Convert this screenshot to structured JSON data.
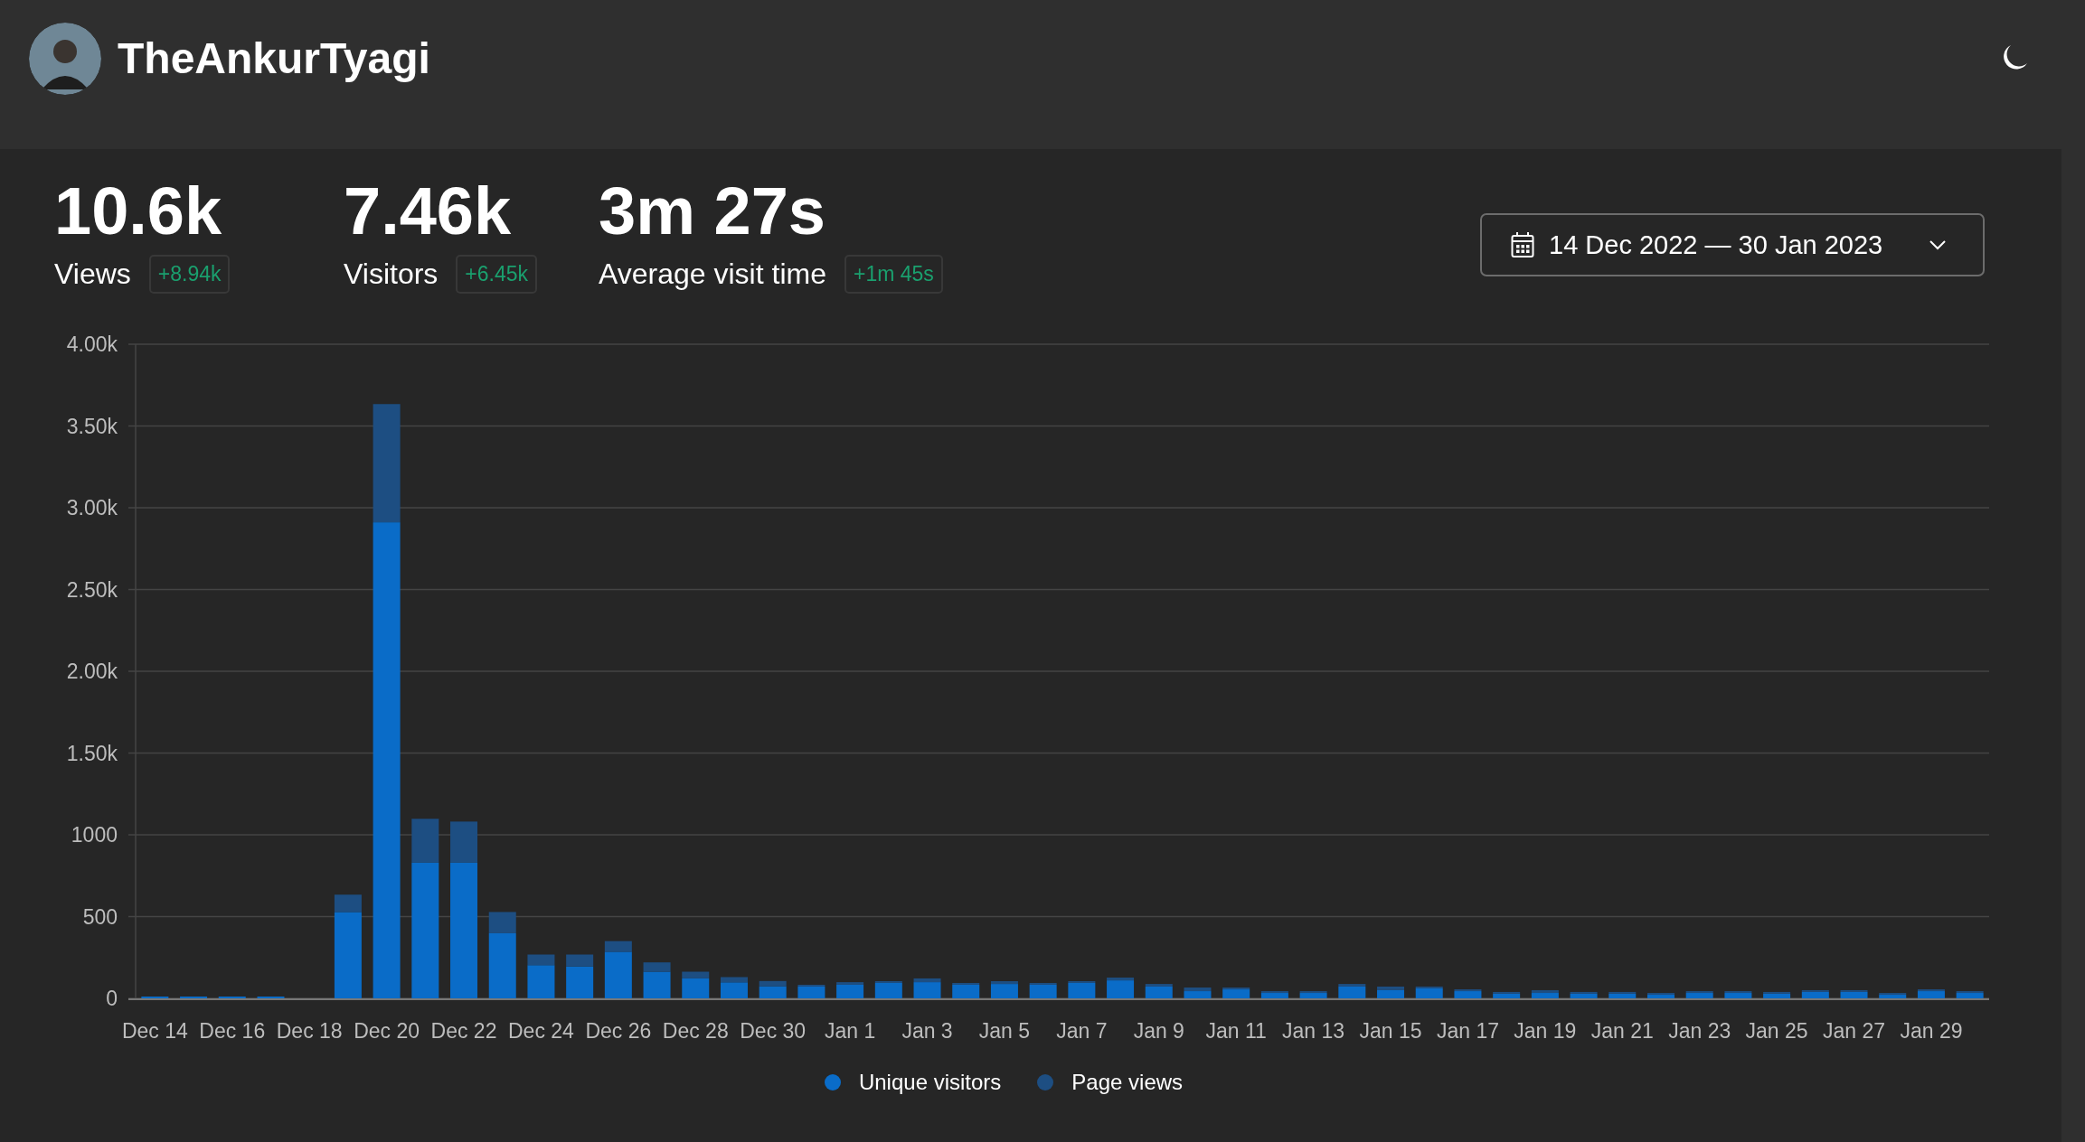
{
  "header": {
    "title": "TheAnkurTyagi"
  },
  "stats": [
    {
      "value": "10.6k",
      "label": "Views",
      "change": "+8.94k"
    },
    {
      "value": "7.46k",
      "label": "Visitors",
      "change": "+6.45k"
    },
    {
      "value": "3m 27s",
      "label": "Average visit time",
      "change": "+1m 45s"
    }
  ],
  "date_range": {
    "label": "14 Dec 2022 — 30 Jan 2023"
  },
  "chart": {
    "chart_data": {
      "type": "bar",
      "stacked": true,
      "grid": true,
      "categories": [
        "Dec 14",
        null,
        "Dec 16",
        null,
        "Dec 18",
        null,
        "Dec 20",
        null,
        "Dec 22",
        null,
        "Dec 24",
        null,
        "Dec 26",
        null,
        "Dec 28",
        null,
        "Dec 30",
        null,
        "Jan 1",
        null,
        "Jan 3",
        null,
        "Jan 5",
        null,
        "Jan 7",
        null,
        "Jan 9",
        null,
        "Jan 11",
        null,
        "Jan 13",
        null,
        "Jan 15",
        null,
        "Jan 17",
        null,
        "Jan 19",
        null,
        "Jan 21",
        null,
        "Jan 23",
        null,
        "Jan 25",
        null,
        "Jan 27",
        null,
        "Jan 29",
        null
      ],
      "series": [
        {
          "name": "Unique visitors",
          "color": "#0a6cc8",
          "values": [
            8,
            6,
            4,
            4,
            0,
            528,
            2911,
            829,
            829,
            398,
            203,
            195,
            285,
            163,
            122,
            98,
            73,
            72,
            83,
            94,
            99,
            83,
            88,
            83,
            94,
            110,
            72,
            44,
            55,
            33,
            33,
            72,
            50,
            61,
            44,
            28,
            33,
            28,
            28,
            22,
            33,
            33,
            28,
            39,
            39,
            22,
            44,
            33
          ]
        },
        {
          "name": "Page views",
          "color": "#1d4e82",
          "values": [
            0,
            0,
            0,
            0,
            0,
            106,
            723,
            269,
            252,
            130,
            65,
            73,
            65,
            57,
            41,
            32,
            33,
            11,
            16,
            11,
            23,
            11,
            17,
            11,
            11,
            17,
            16,
            22,
            11,
            6,
            6,
            16,
            22,
            5,
            6,
            5,
            17,
            5,
            5,
            6,
            6,
            6,
            5,
            5,
            5,
            6,
            11,
            6
          ]
        }
      ],
      "ylim": [
        0,
        4000
      ],
      "yticks": [
        {
          "value": 0,
          "label": "0"
        },
        {
          "value": 500,
          "label": "500"
        },
        {
          "value": 1000,
          "label": "1000"
        },
        {
          "value": 1500,
          "label": "1.50k"
        },
        {
          "value": 2000,
          "label": "2.00k"
        },
        {
          "value": 2500,
          "label": "2.50k"
        },
        {
          "value": 3000,
          "label": "3.00k"
        },
        {
          "value": 3500,
          "label": "3.50k"
        },
        {
          "value": 4000,
          "label": "4.00k"
        }
      ]
    }
  }
}
